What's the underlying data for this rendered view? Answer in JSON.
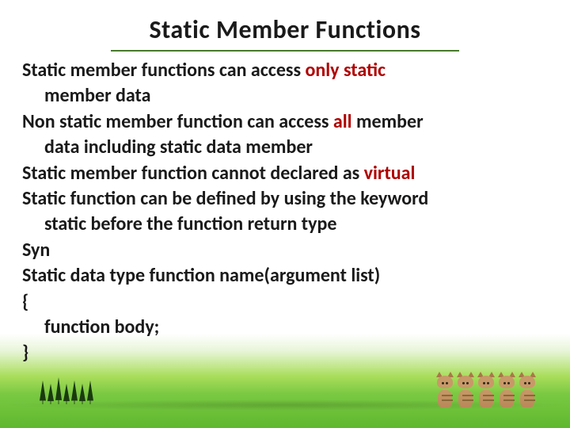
{
  "slide": {
    "title": "Static  Member Functions",
    "lines": {
      "l1a": "Static member functions can access ",
      "l1red": "only static",
      "l1b_indent": "member data",
      "l2a": "Non static member function can access ",
      "l2red": "all",
      "l2b": " member",
      "l2c_indent": "data including static data member",
      "l3a": "Static member function cannot declared as ",
      "l3red": "virtual",
      "l4": "Static function can be defined by using the keyword",
      "l4b_indent": "static before the function return type",
      "l5": "Syn",
      "l6": "Static data type function name(argument list)",
      "l7": "{",
      "l8_indent": "function body;",
      "l9": "}"
    }
  }
}
